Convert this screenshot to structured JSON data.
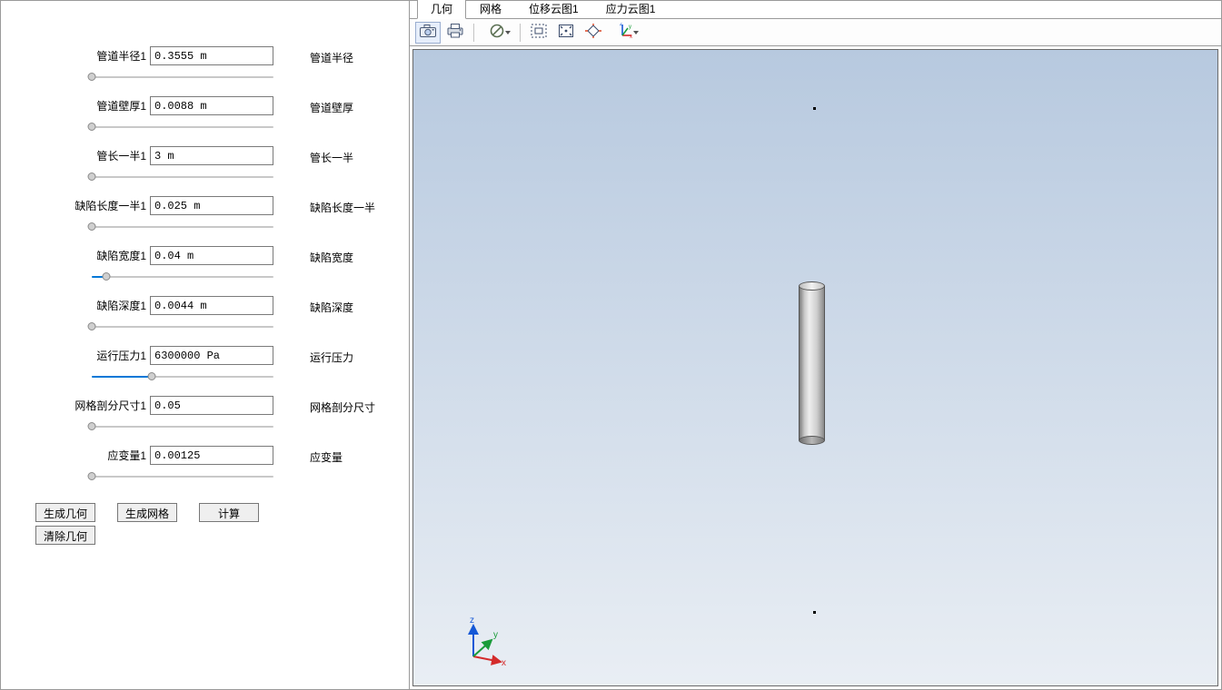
{
  "params": [
    {
      "label": "管道半径1",
      "value": "0.3555 m",
      "rlabel": "管道半径",
      "thumb": 0,
      "fill": 0
    },
    {
      "label": "管道壁厚1",
      "value": "0.0088 m",
      "rlabel": "管道壁厚",
      "thumb": 0,
      "fill": 0
    },
    {
      "label": "管长一半1",
      "value": "3 m",
      "rlabel": "管长一半",
      "thumb": 0,
      "fill": 0
    },
    {
      "label": "缺陷长度一半1",
      "value": "0.025 m",
      "rlabel": "缺陷长度一半",
      "thumb": 0,
      "fill": 0
    },
    {
      "label": "缺陷宽度1",
      "value": "0.04 m",
      "rlabel": "缺陷宽度",
      "thumb": 8,
      "fill": 0.08
    },
    {
      "label": "缺陷深度1",
      "value": "0.0044 m",
      "rlabel": "缺陷深度",
      "thumb": 0,
      "fill": 0
    },
    {
      "label": "运行压力1",
      "value": "6300000 Pa",
      "rlabel": "运行压力",
      "thumb": 33,
      "fill": 0.33
    },
    {
      "label": "网格剖分尺寸1",
      "value": "0.05",
      "rlabel": "网格剖分尺寸",
      "thumb": 0,
      "fill": 0
    },
    {
      "label": "应变量1",
      "value": "0.00125",
      "rlabel": "应变量",
      "thumb": 0,
      "fill": 0
    }
  ],
  "buttons": {
    "generate_geometry": "生成几何",
    "generate_mesh": "生成网格",
    "compute": "计算",
    "clear_geometry": "清除几何"
  },
  "tabs": [
    {
      "label": "几何",
      "active": true
    },
    {
      "label": "网格",
      "active": false
    },
    {
      "label": "位移云图1",
      "active": false
    },
    {
      "label": "应力云图1",
      "active": false
    }
  ],
  "triad": {
    "x": "x",
    "y": "y",
    "z": "z"
  }
}
